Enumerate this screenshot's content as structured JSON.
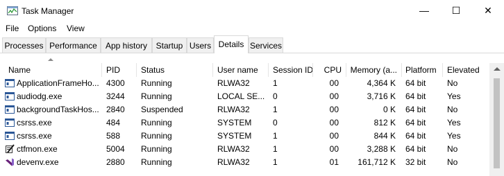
{
  "window": {
    "title": "Task Manager"
  },
  "controls": {
    "minimize": "—",
    "maximize": "☐",
    "close": "✕"
  },
  "menu": [
    "File",
    "Options",
    "View"
  ],
  "tabs": [
    "Processes",
    "Performance",
    "App history",
    "Startup",
    "Users",
    "Details",
    "Services"
  ],
  "active_tab": "Details",
  "columns": [
    "Name",
    "PID",
    "Status",
    "User name",
    "Session ID",
    "CPU",
    "Memory (a...",
    "Platform",
    "Elevated"
  ],
  "rows": [
    {
      "name": "ApplicationFrameHo...",
      "pid": "4300",
      "status": "Running",
      "user": "RLWA32",
      "session": "1",
      "cpu": "00",
      "memory": "4,364 K",
      "platform": "64 bit",
      "elevated": "No",
      "icon": "window-app-icon"
    },
    {
      "name": "audiodg.exe",
      "pid": "3244",
      "status": "Running",
      "user": "LOCAL SE...",
      "session": "0",
      "cpu": "00",
      "memory": "3,716 K",
      "platform": "64 bit",
      "elevated": "Yes",
      "icon": "window-app-icon"
    },
    {
      "name": "backgroundTaskHos...",
      "pid": "2840",
      "status": "Suspended",
      "user": "RLWA32",
      "session": "1",
      "cpu": "00",
      "memory": "0 K",
      "platform": "64 bit",
      "elevated": "No",
      "icon": "window-app-icon"
    },
    {
      "name": "csrss.exe",
      "pid": "484",
      "status": "Running",
      "user": "SYSTEM",
      "session": "0",
      "cpu": "00",
      "memory": "812 K",
      "platform": "64 bit",
      "elevated": "Yes",
      "icon": "window-app-icon"
    },
    {
      "name": "csrss.exe",
      "pid": "588",
      "status": "Running",
      "user": "SYSTEM",
      "session": "1",
      "cpu": "00",
      "memory": "844 K",
      "platform": "64 bit",
      "elevated": "Yes",
      "icon": "window-app-icon"
    },
    {
      "name": "ctfmon.exe",
      "pid": "5004",
      "status": "Running",
      "user": "RLWA32",
      "session": "1",
      "cpu": "00",
      "memory": "3,288 K",
      "platform": "64 bit",
      "elevated": "No",
      "icon": "pen-notepad-icon"
    },
    {
      "name": "devenv.exe",
      "pid": "2880",
      "status": "Running",
      "user": "RLWA32",
      "session": "1",
      "cpu": "01",
      "memory": "161,712 K",
      "platform": "32 bit",
      "elevated": "No",
      "icon": "visual-studio-icon"
    }
  ]
}
